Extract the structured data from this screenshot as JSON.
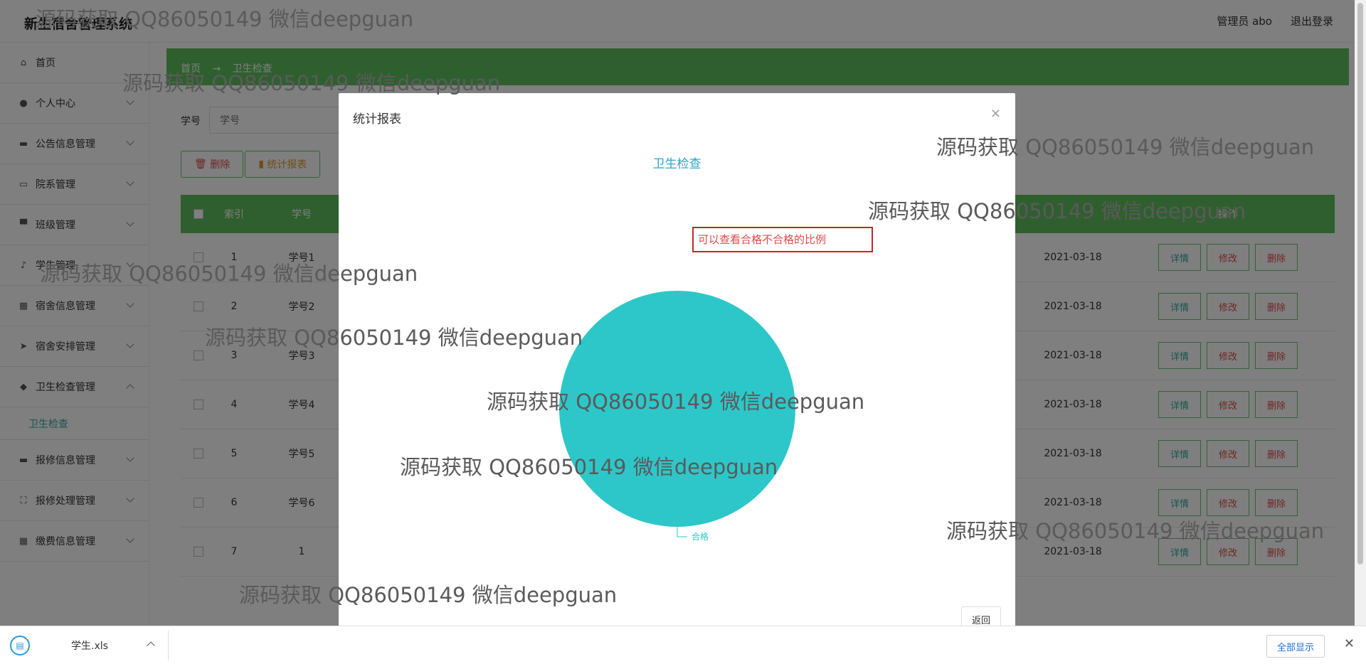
{
  "header": {
    "app_title": "新生宿舍管理系统",
    "user_label": "管理员 abo",
    "logout_label": "退出登录"
  },
  "sidebar": {
    "items": [
      {
        "label": "首页",
        "icon": "home-icon"
      },
      {
        "label": "个人中心",
        "icon": "user-icon"
      },
      {
        "label": "公告信息管理",
        "icon": "message-icon"
      },
      {
        "label": "院系管理",
        "icon": "card-icon"
      },
      {
        "label": "班级管理",
        "icon": "flag-icon"
      },
      {
        "label": "学生管理",
        "icon": "mic-icon"
      },
      {
        "label": "宿舍信息管理",
        "icon": "building-icon"
      },
      {
        "label": "宿舍安排管理",
        "icon": "send-icon"
      },
      {
        "label": "卫生检查管理",
        "icon": "drop-icon"
      },
      {
        "label": "报修信息管理",
        "icon": "monitor-icon"
      },
      {
        "label": "报修处理管理",
        "icon": "scan-icon"
      },
      {
        "label": "缴费信息管理",
        "icon": "grid-icon"
      }
    ],
    "sub_item": "卫生检查"
  },
  "content": {
    "breadcrumb": [
      "首页",
      "→",
      "卫生检查"
    ],
    "search_label": "学号",
    "search_placeholder": "学号",
    "delete_button": "删除",
    "report_button": "统计报表",
    "table_headers": [
      "索引",
      "学号"
    ],
    "ops_header": "操作",
    "rows": [
      {
        "index": "1",
        "sno": "学号1",
        "date": "2021-03-18"
      },
      {
        "index": "2",
        "sno": "学号2",
        "date": "2021-03-18"
      },
      {
        "index": "3",
        "sno": "学号3",
        "date": "2021-03-18"
      },
      {
        "index": "4",
        "sno": "学号4",
        "date": "2021-03-18"
      },
      {
        "index": "5",
        "sno": "学号5",
        "date": "2021-03-18"
      },
      {
        "index": "6",
        "sno": "学号6",
        "date": "2021-03-18"
      },
      {
        "index": "7",
        "sno": "1",
        "date": "2021-03-18"
      }
    ],
    "op_detail": "详情",
    "op_edit": "修改",
    "op_delete": "删除"
  },
  "modal": {
    "title": "统计报表",
    "close_glyph": "×",
    "note_text": "可以查看合格不合格的比例",
    "back_button": "返回"
  },
  "chart_data": {
    "type": "pie",
    "title": "卫生检查",
    "slices": [
      {
        "name": "合格",
        "value": 100,
        "color": "#2ec7c9"
      }
    ]
  },
  "watermark_text": "源码获取 QQ86050149 微信deepguan",
  "download_bar": {
    "file_name": "学生.xls",
    "show_all": "全部显示",
    "close_glyph": "✕"
  },
  "colors": {
    "accent_green": "#5fbf5f",
    "pie_teal": "#2ec7c9",
    "chart_title_blue": "#2aa6c4"
  }
}
